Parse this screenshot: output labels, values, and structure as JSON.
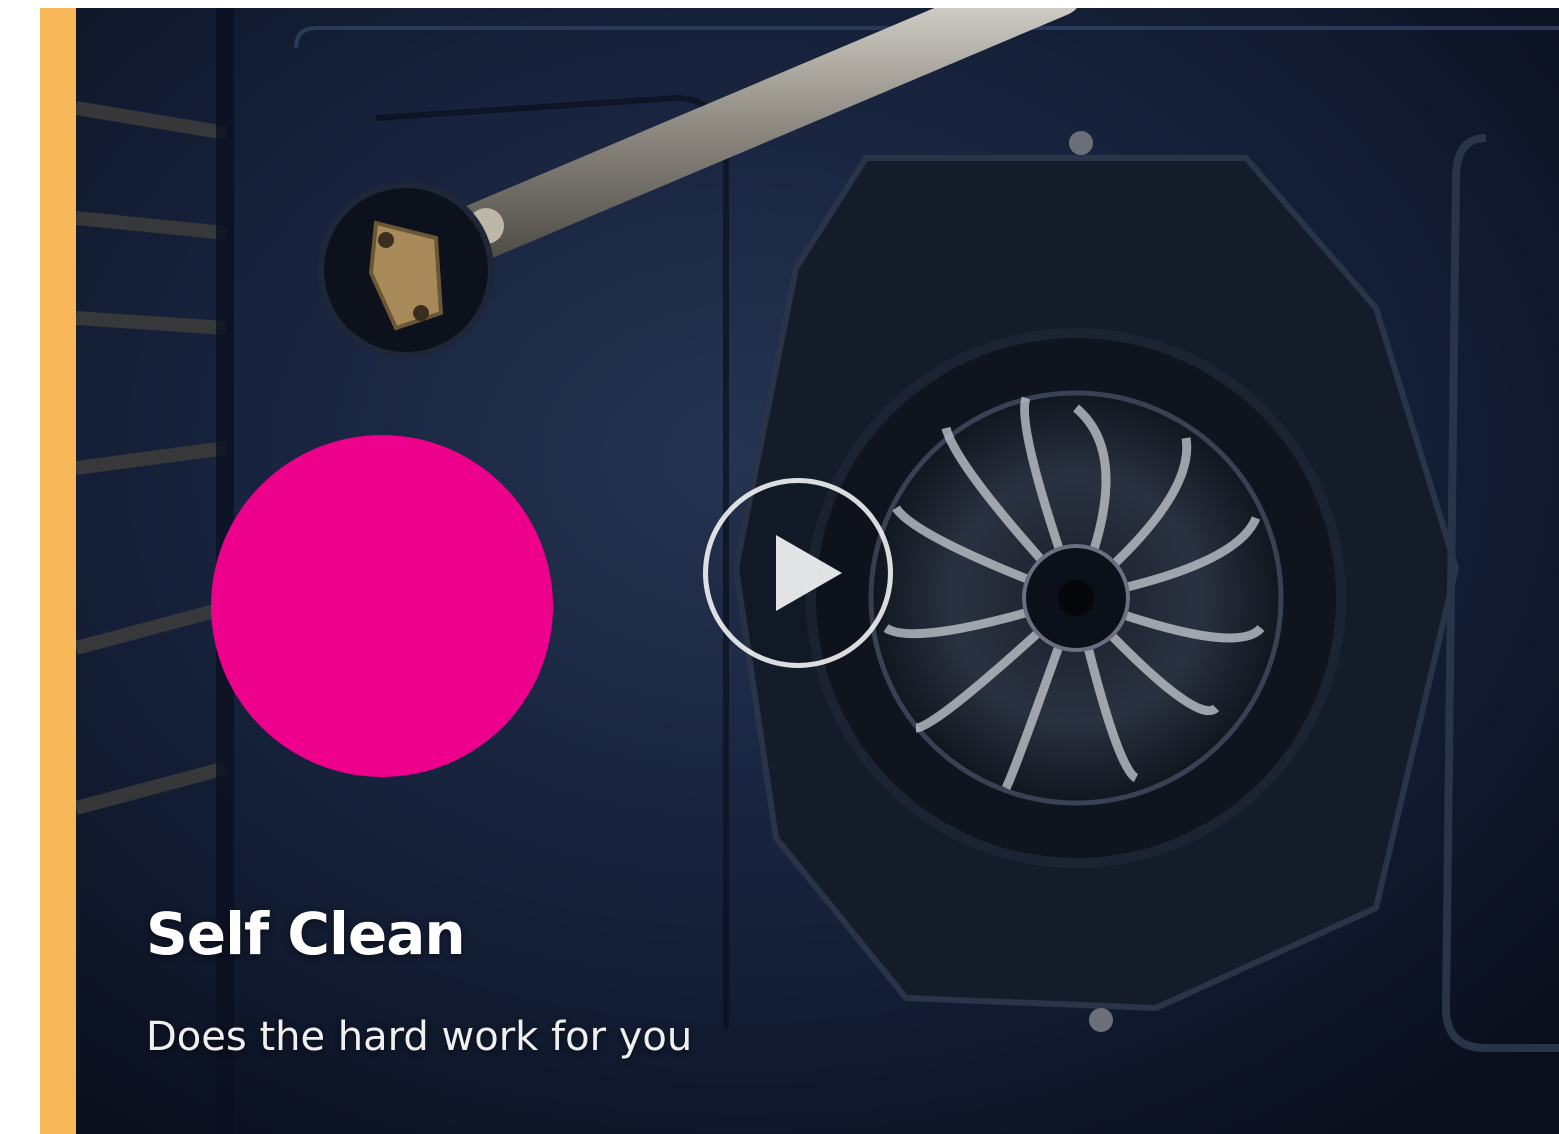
{
  "hero": {
    "title": "Self Clean",
    "subtitle": "Does the hard work for you"
  },
  "icons": {
    "play": "play-icon"
  },
  "colors": {
    "accent_bar": "#f8b85a",
    "pink_dot": "#ec008c",
    "background": "#0f1626"
  }
}
